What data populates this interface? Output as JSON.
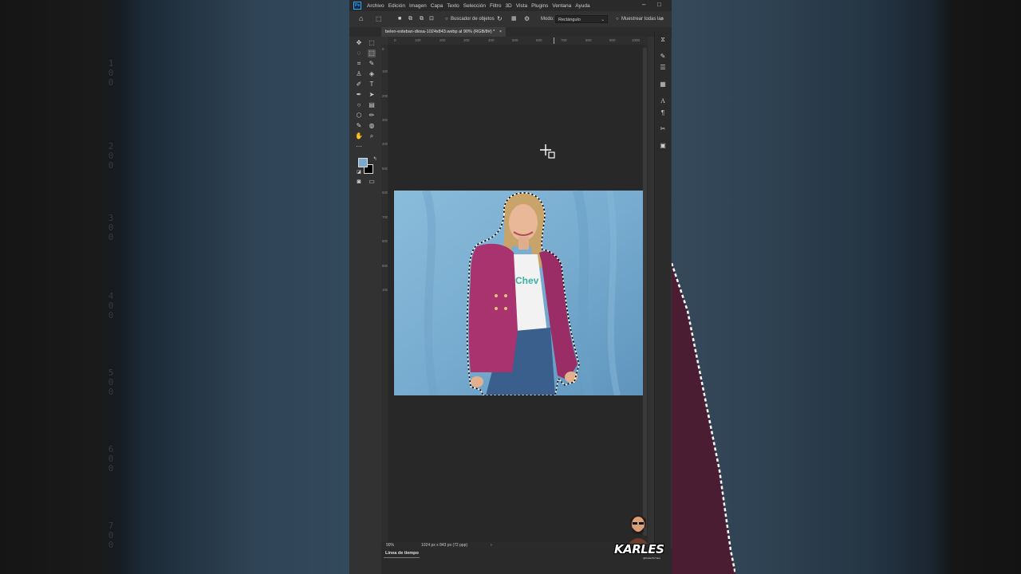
{
  "background": {
    "left_ruler_ghost": [
      "1\n0\n0",
      "2\n0\n0",
      "3\n0\n0",
      "4\n0\n0",
      "5\n0\n0",
      "6\n0\n0",
      "7\n0\n0"
    ]
  },
  "app": {
    "logo": "Ps",
    "menu": [
      "Archivo",
      "Edición",
      "Imagen",
      "Capa",
      "Texto",
      "Selección",
      "Filtro",
      "3D",
      "Vista",
      "Plugins",
      "Ventana",
      "Ayuda"
    ],
    "window_controls": {
      "minimize": "–",
      "maximize": "□"
    }
  },
  "options_bar": {
    "object_finder": "Buscador de objetos",
    "mode_label": "Modo:",
    "mode_value": "Rectángulo",
    "sample_all": "Muestrear todas las"
  },
  "document": {
    "tab_title": "belen-esteban-diosa-1024x843.webp al 90% (RGB/8#) *",
    "close": "×"
  },
  "rulers": {
    "horizontal": [
      "0",
      "100",
      "200",
      "300",
      "400",
      "500",
      "600",
      "700",
      "800",
      "900",
      "1000"
    ],
    "vertical": [
      "0",
      "100",
      "200",
      "300",
      "400",
      "500",
      "600",
      "700",
      "800",
      "900",
      "1000"
    ]
  },
  "status": {
    "zoom": "90%",
    "dimensions": "1024 px x 843 px (72 ppp)",
    "arrow": "›"
  },
  "timeline": {
    "label": "Línea de tiempo"
  },
  "colors": {
    "foreground": "#7aaad0",
    "background": "#000000",
    "jacket": "#a8336f",
    "backdrop": "#7db1d4"
  },
  "watermark": {
    "name": "KARLES",
    "sub": "@KarlesTuTutor"
  },
  "photo": {
    "shirt_text": "Chev"
  }
}
